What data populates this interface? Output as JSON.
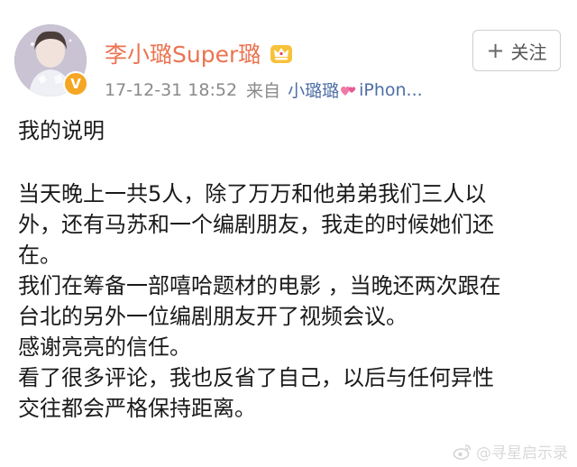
{
  "post": {
    "author": {
      "name": "李小璐Super璐",
      "avatar": "portrait-photo",
      "verified_badge_icon": "verified-v-icon",
      "vip_icon": "crown-vip-icon"
    },
    "meta": {
      "timestamp": "17-12-31 18:52",
      "from_label": "来自",
      "source_name": "小璐璐",
      "source_icon": "hearts-icon",
      "source_device": "iPhon..."
    },
    "follow_button": {
      "icon": "plus-icon",
      "label": "关注"
    },
    "content": {
      "heading": "我的说明",
      "lines": [
        "当天晚上一共5人，除了万万和他弟弟我们三人以",
        "外，还有马苏和一个编剧朋友，我走的时候她们还",
        "在。",
        "我们在筹备一部嘻哈题材的电影 ，当晚还两次跟在",
        "台北的另外一位编剧朋友开了视频会议。",
        "感谢亮亮的信任。",
        "看了很多评论，我也反省了自己，以后与任何异性",
        "交往都会严格保持距离。"
      ]
    },
    "watermark": {
      "icon": "weibo-icon",
      "text": "@寻星启示录"
    }
  },
  "colors": {
    "username": "#eb7350",
    "link": "#4e6ea6",
    "meta": "#8a8a8a",
    "verified_badge": "#f5a623"
  }
}
